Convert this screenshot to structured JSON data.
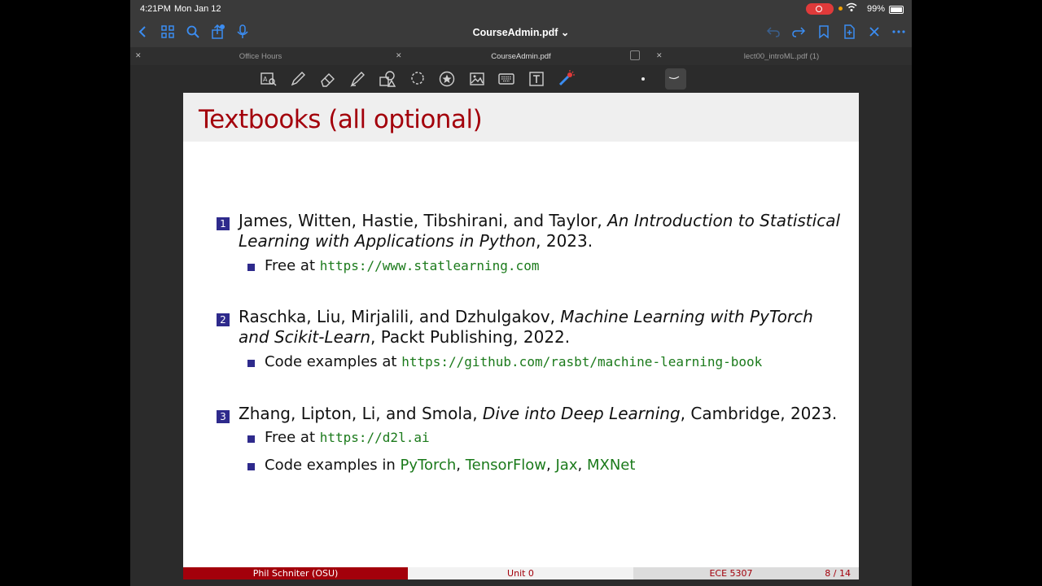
{
  "status_bar": {
    "time": "4:21PM",
    "date": "Mon Jan 12",
    "battery": "99%"
  },
  "nav": {
    "title": "CourseAdmin.pdf ⌄"
  },
  "tabs": [
    {
      "label": "Office Hours"
    },
    {
      "label": "CourseAdmin.pdf"
    },
    {
      "label": "lect00_introML.pdf (1)"
    }
  ],
  "toolbar_tools": [
    "text-select-icon",
    "pen-icon",
    "eraser-icon",
    "highlighter-icon",
    "shapes-icon",
    "lasso-icon",
    "star-icon",
    "image-icon",
    "keyboard-icon",
    "text-box-icon",
    "laser-pointer-icon",
    "dot-size-icon",
    "stroke-style-icon"
  ],
  "slide": {
    "title": "Textbooks (all optional)",
    "items": [
      {
        "number": "1",
        "authors": "James, Witten, Hastie, Tibshirani, and Taylor, ",
        "book": "An Introduction to Statistical Learning with Applications in Python",
        "rest": ", 2023.",
        "subs": [
          {
            "prefix": "Free at ",
            "url": "https://www.statlearning.com"
          }
        ]
      },
      {
        "number": "2",
        "authors": "Raschka, Liu, Mirjalili, and Dzhulgakov, ",
        "book": "Machine Learning with PyTorch and Scikit-Learn",
        "rest": ", Packt Publishing, 2022.",
        "subs": [
          {
            "prefix": "Code examples at ",
            "url": "https://github.com/rasbt/machine-learning-book"
          }
        ]
      },
      {
        "number": "3",
        "authors": "Zhang, Lipton, Li, and Smola, ",
        "book": "Dive into Deep Learning",
        "rest": ", Cambridge, 2023.",
        "subs": [
          {
            "prefix": "Free at ",
            "url": "https://d2l.ai"
          },
          {
            "prefix": "Code examples in ",
            "links": [
              "PyTorch",
              "TensorFlow",
              "Jax",
              "MXNet"
            ]
          }
        ]
      }
    ],
    "footer": {
      "author": "Phil Schniter  (OSU)",
      "unit": "Unit 0",
      "course": "ECE 5307",
      "page": "8 / 14"
    }
  },
  "colors": {
    "accent_red": "#a3000b",
    "bullet_blue": "#2e2a8c",
    "link_green": "#1b7a1b",
    "ios_blue": "#3b8df2"
  }
}
